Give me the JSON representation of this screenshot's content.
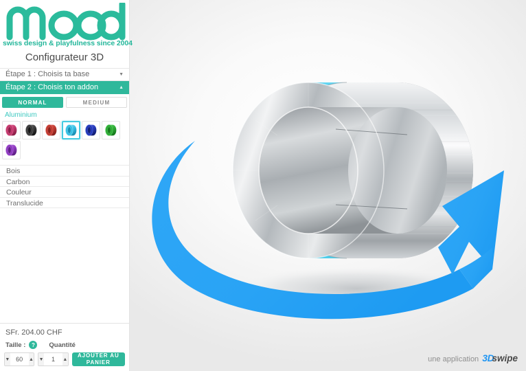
{
  "brand": {
    "logo_text": "mood",
    "tagline": "swiss design & playfulness since 2004",
    "logo_color": "#2bbb9c"
  },
  "sidebar": {
    "configurator_title": "Configurateur 3D",
    "steps": [
      {
        "label": "Étape 1 : Choisis ta base",
        "caret": "▼",
        "active": false
      },
      {
        "label": "Étape 2 : Choisis ton addon",
        "caret": "▲",
        "active": true
      }
    ],
    "tabs": [
      {
        "label": "NORMAL",
        "active": true
      },
      {
        "label": "MEDIUM",
        "active": false
      }
    ],
    "material_group": "Aluminium",
    "swatches": [
      {
        "name": "rose",
        "color": "#c0386b",
        "light": "#e36a98",
        "dark": "#8d1f48",
        "selected": false
      },
      {
        "name": "noir",
        "color": "#3b3b3b",
        "light": "#6e6e6e",
        "dark": "#161616",
        "selected": false
      },
      {
        "name": "rouge",
        "color": "#bf3b32",
        "light": "#e2685e",
        "dark": "#8a221c",
        "selected": false
      },
      {
        "name": "cyan",
        "color": "#35bfe4",
        "light": "#8ee2f4",
        "dark": "#1a8fb4",
        "selected": true
      },
      {
        "name": "bleu",
        "color": "#2438b6",
        "light": "#5a6be0",
        "dark": "#131e74",
        "selected": false
      },
      {
        "name": "vert",
        "color": "#2faa36",
        "light": "#5fd566",
        "dark": "#177a1d",
        "selected": false
      },
      {
        "name": "violet",
        "color": "#8e3bbf",
        "light": "#b671e0",
        "dark": "#5f1f85",
        "selected": false
      }
    ],
    "categories": [
      "Bois",
      "Carbon",
      "Couleur",
      "Translucide"
    ]
  },
  "buy": {
    "price": "SFr. 204.00 CHF",
    "size_label": "Taille :",
    "help_glyph": "?",
    "quantity_label": "Quantité",
    "size_value": "60",
    "quantity_value": "1",
    "cart_button": "AJOUTER AU PANIER",
    "down_glyph": "▼",
    "up_glyph": "▲"
  },
  "viewport": {
    "product": {
      "type": "ring",
      "material": "aluminium",
      "band_color": "#b9bdc0",
      "accent_color": "#3fc3e8"
    },
    "rotate_hint_arrow_color": "#29a3f5"
  },
  "footer": {
    "prefix": "une application",
    "brand_3d": "3D",
    "brand_swipe": "swipe"
  }
}
